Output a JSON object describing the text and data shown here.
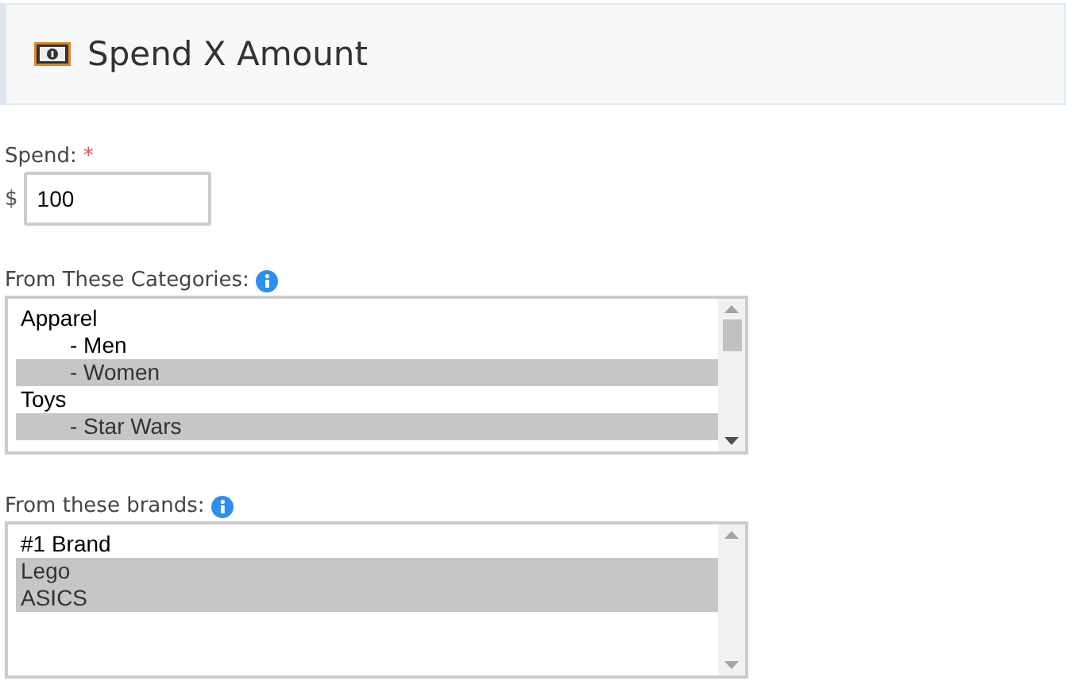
{
  "header": {
    "title": "Spend X Amount"
  },
  "spend": {
    "label": "Spend:",
    "required_mark": "*",
    "currency": "$",
    "value": "100"
  },
  "categories": {
    "label": "From These Categories:",
    "items": [
      {
        "label": "Apparel",
        "selected": false,
        "children": [
          {
            "label": "- Men",
            "selected": false
          },
          {
            "label": "- Women",
            "selected": true
          }
        ]
      },
      {
        "label": "Toys",
        "selected": false,
        "children": [
          {
            "label": "- Star Wars",
            "selected": true
          }
        ]
      }
    ]
  },
  "brands": {
    "label": "From these brands:",
    "items": [
      {
        "label": "#1 Brand",
        "selected": false
      },
      {
        "label": "Lego",
        "selected": true
      },
      {
        "label": "ASICS",
        "selected": true
      }
    ]
  }
}
